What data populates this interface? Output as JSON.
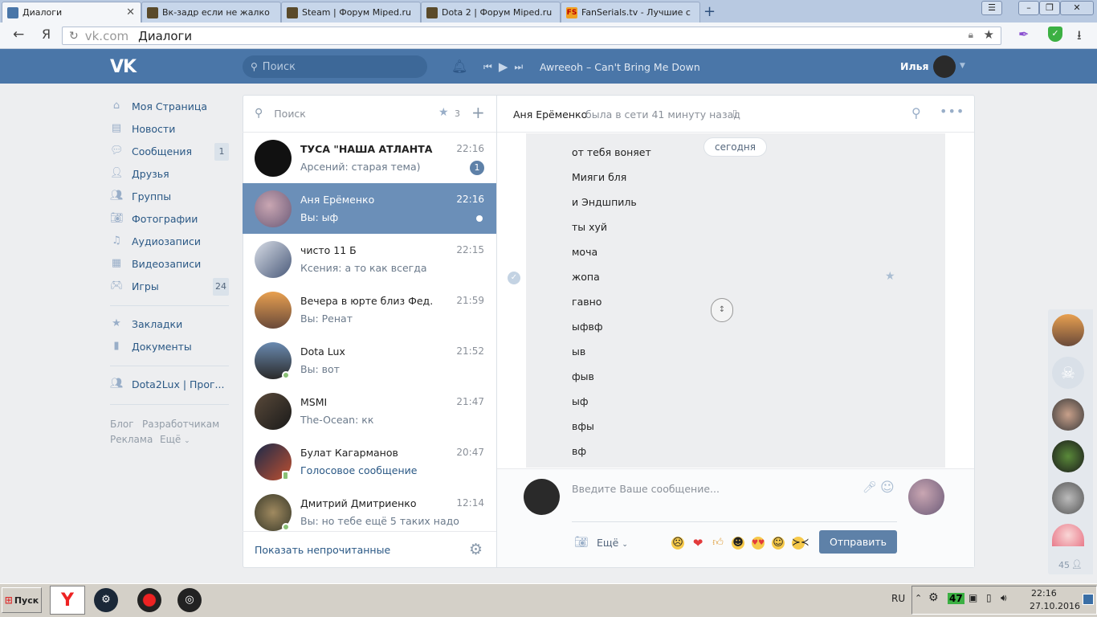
{
  "browser": {
    "tabs": [
      {
        "title": "Диалоги",
        "active": true
      },
      {
        "title": "Вк-задр если не жалко"
      },
      {
        "title": "Steam | Форум Miped.ru"
      },
      {
        "title": "Dota 2 | Форум Miped.ru"
      },
      {
        "title": "FanSerials.tv - Лучшие с"
      }
    ],
    "url_domain": "vk.com",
    "url_title": "Диалоги"
  },
  "vk_header": {
    "logo": "VK",
    "search_placeholder": "Поиск",
    "track": "Awreeoh – Can't Bring Me Down",
    "user_name": "Илья"
  },
  "left_nav": {
    "items": [
      {
        "label": "Моя Страница",
        "icon": "home-icon"
      },
      {
        "label": "Новости",
        "icon": "news-icon"
      },
      {
        "label": "Сообщения",
        "icon": "messages-icon",
        "count": "1"
      },
      {
        "label": "Друзья",
        "icon": "friends-icon"
      },
      {
        "label": "Группы",
        "icon": "groups-icon"
      },
      {
        "label": "Фотографии",
        "icon": "camera-icon"
      },
      {
        "label": "Аудиозаписи",
        "icon": "music-icon"
      },
      {
        "label": "Видеозаписи",
        "icon": "video-icon"
      },
      {
        "label": "Игры",
        "icon": "gamepad-icon",
        "count": "24"
      }
    ],
    "items2": [
      {
        "label": "Закладки",
        "icon": "star-icon"
      },
      {
        "label": "Документы",
        "icon": "document-icon"
      }
    ],
    "group": {
      "label": "Dota2Lux | Прог...",
      "icon": "group-icon"
    },
    "footer": {
      "blog": "Блог",
      "dev": "Разработчикам",
      "ads": "Реклама",
      "more": "Ещё"
    }
  },
  "dialogs": {
    "search_placeholder": "Поиск",
    "starred_count": "3",
    "items": [
      {
        "name": "ТУСА \"НАША АТЛАНТА\"",
        "time": "22:16",
        "message": "Арсений: старая тема)",
        "badge": "1"
      },
      {
        "name": "Аня Ерёменко",
        "time": "22:16",
        "message": "Вы: ыф",
        "selected": true
      },
      {
        "name": "чисто 11 Б",
        "time": "22:15",
        "message": "Ксения: а то как всегда"
      },
      {
        "name": "Вечера в юрте близ Фед...",
        "time": "21:59",
        "message": "Вы: Ренат"
      },
      {
        "name": "Dota Lux",
        "time": "21:52",
        "message": "Вы: вот"
      },
      {
        "name": "MSMI",
        "time": "21:47",
        "message": "The-Ocean: кк"
      },
      {
        "name": "Булат Кагарманов",
        "time": "20:47",
        "message": "Голосовое сообщение"
      },
      {
        "name": "Дмитрий Дмитриенко",
        "time": "12:14",
        "message": "Вы: но тебе ещё 5 таких надо"
      }
    ],
    "show_unread": "Показать непрочитанные"
  },
  "chat": {
    "peer_name": "Аня Ерёменко",
    "peer_status": "была в сети 41 минуту назад",
    "date_divider": "сегодня",
    "messages": [
      "от тебя воняет",
      "Мияги бля",
      "и Эндшпиль",
      "ты хуй",
      "моча",
      "жопа",
      "гавно",
      "ыфвф",
      "ыв",
      "фыв",
      "ыф",
      "вфы",
      "вф"
    ],
    "input_placeholder": "Введите Ваше сообщение...",
    "more_label": "Ещё",
    "send_label": "Отправить"
  },
  "right_list": {
    "count": "45"
  },
  "taskbar": {
    "start": "Пуск",
    "lang": "RU",
    "tray_badge": "47",
    "time": "22:16",
    "date": "27.10.2016"
  },
  "colors": {
    "vk_blue": "#4a76a8",
    "selected_dialog": "#6b8fb8",
    "send_button": "#5e81a8"
  }
}
